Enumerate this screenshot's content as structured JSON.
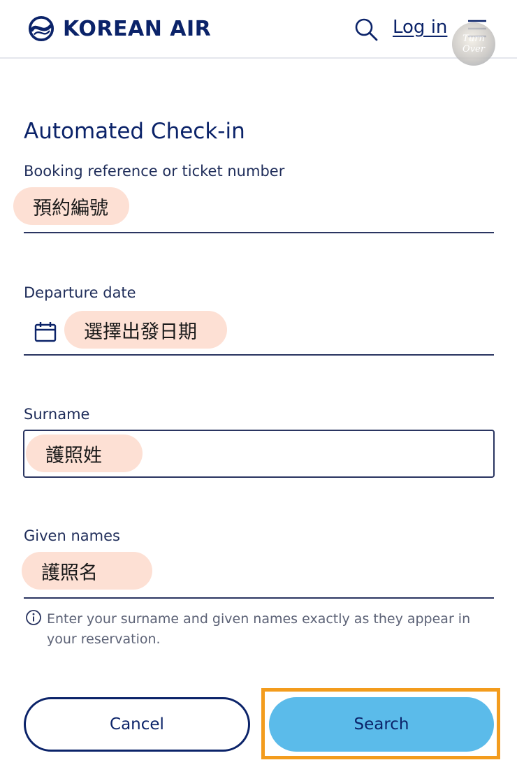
{
  "header": {
    "brand": "KOREAN AIR",
    "login_label": "Log in",
    "watermark_line1": "Turn",
    "watermark_line2": "Over"
  },
  "form": {
    "title": "Automated Check-in",
    "booking": {
      "label": "Booking reference or ticket number",
      "value": "預約編號"
    },
    "departure": {
      "label": "Departure date",
      "value": "選擇出發日期"
    },
    "surname": {
      "label": "Surname",
      "value": "護照姓"
    },
    "given": {
      "label": "Given names",
      "value": "護照名"
    },
    "helper": "Enter your surname and given names exactly as they appear in your reservation."
  },
  "buttons": {
    "cancel": "Cancel",
    "search": "Search"
  },
  "colors": {
    "brand_navy": "#0b2369",
    "search_button": "#5bbbea",
    "highlight": "#f39c1d",
    "annotation_pill": "#fde0d4"
  },
  "icons": [
    "korean-air-logo-icon",
    "search-icon",
    "menu-icon",
    "calendar-icon",
    "info-icon"
  ]
}
